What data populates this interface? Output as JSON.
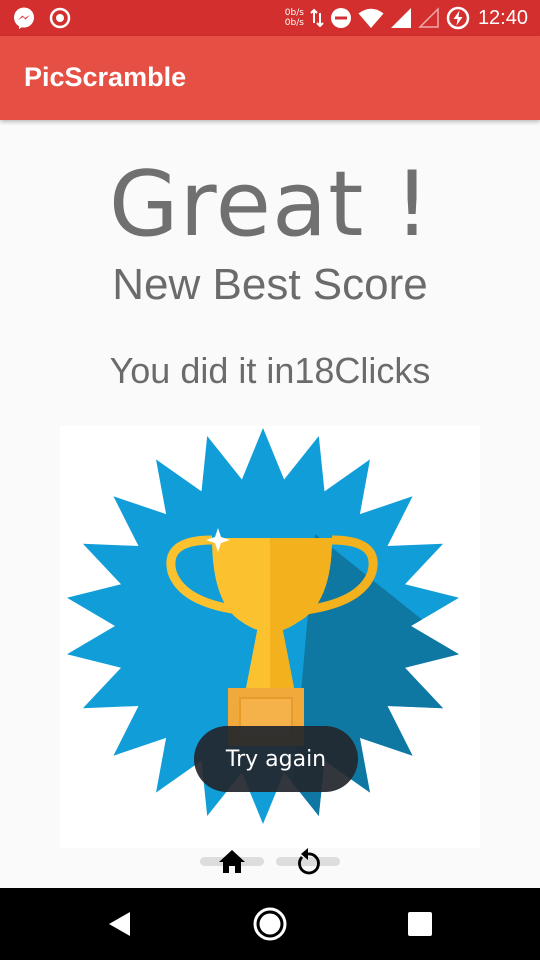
{
  "status_bar": {
    "net_speed_up": "0b/s",
    "net_speed_down": "0b/s",
    "time": "12:40",
    "icons": [
      "messenger-icon",
      "record-icon",
      "data-transfer-icon",
      "do-not-disturb-icon",
      "wifi-icon",
      "signal-icon",
      "signal-empty-icon",
      "battery-saver-icon"
    ]
  },
  "app_bar": {
    "title": "PicScramble",
    "color": "#e65044"
  },
  "result": {
    "headline": "Great !",
    "subhead": "New Best Score",
    "clicks_line": "You did it in18Clicks"
  },
  "trophy": {
    "icon": "trophy-badge-icon",
    "badge_color": "#119ed8",
    "trophy_color": "#fcc12f"
  },
  "toast": {
    "message": "Try again"
  },
  "actions": {
    "home_icon": "home-icon",
    "restart_icon": "restart-icon"
  },
  "nav_bar": {
    "icons": [
      "back-icon",
      "home-circle-icon",
      "recents-icon"
    ]
  }
}
